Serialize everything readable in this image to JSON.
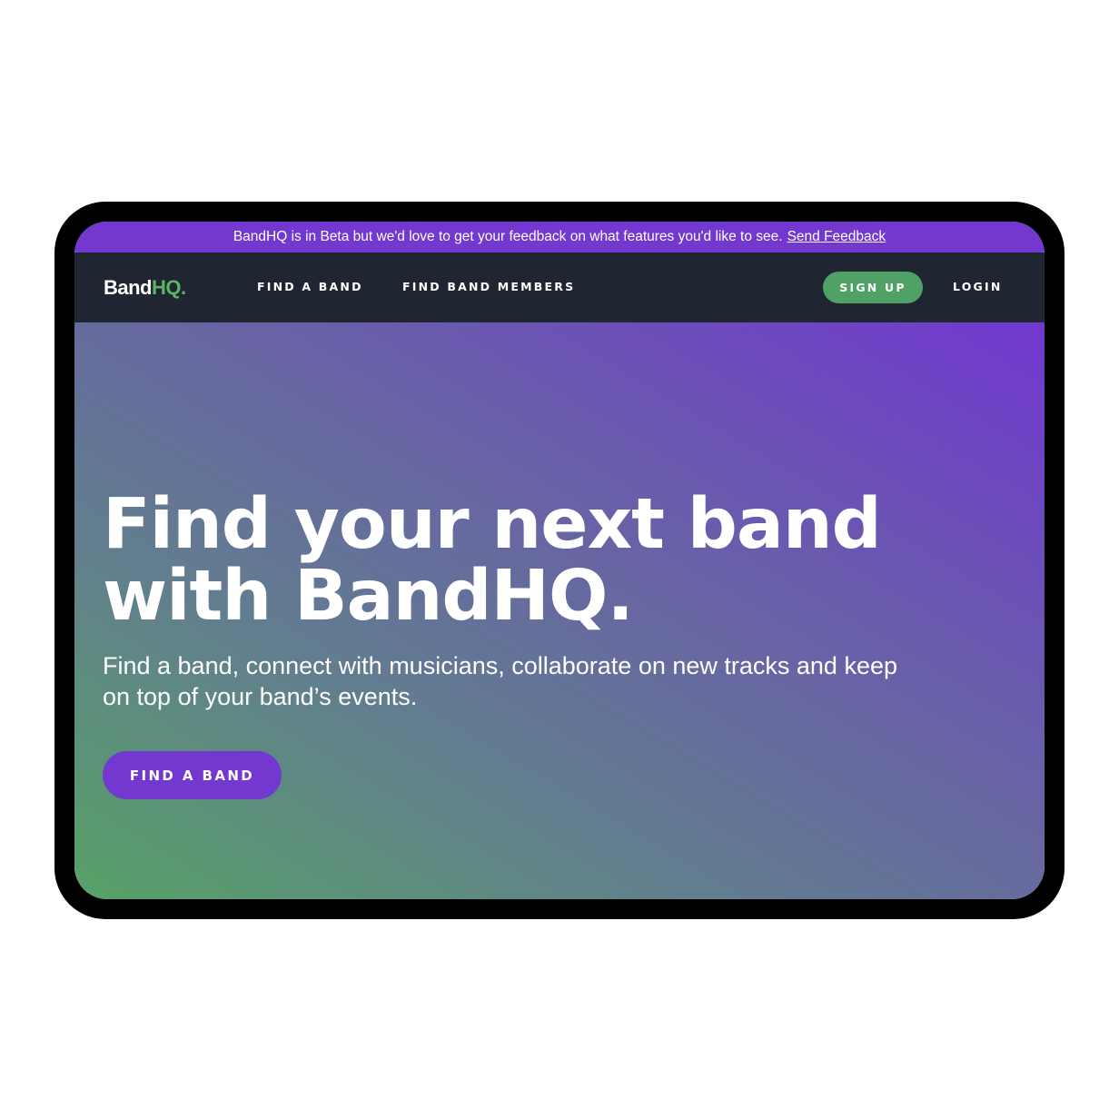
{
  "beta_banner": {
    "text": "BandHQ is in Beta but we'd love to get your feedback on what features you'd like to see.",
    "link_label": "Send Feedback"
  },
  "nav": {
    "logo_primary": "Band",
    "logo_accent": "HQ.",
    "links": [
      {
        "label": "FIND A BAND"
      },
      {
        "label": "FIND BAND MEMBERS"
      }
    ],
    "signup_label": "SIGN UP",
    "login_label": "LOGIN"
  },
  "hero": {
    "title_line1": "Find your next band",
    "title_line2": "with BandHQ.",
    "subtitle": "Find a band, connect with musicians, collaborate on new tracks and keep on top of your band’s events.",
    "cta_label": "FIND A BAND"
  },
  "colors": {
    "accent_purple": "#7338cf",
    "accent_green": "#4fa166",
    "nav_background": "#1f2632"
  }
}
